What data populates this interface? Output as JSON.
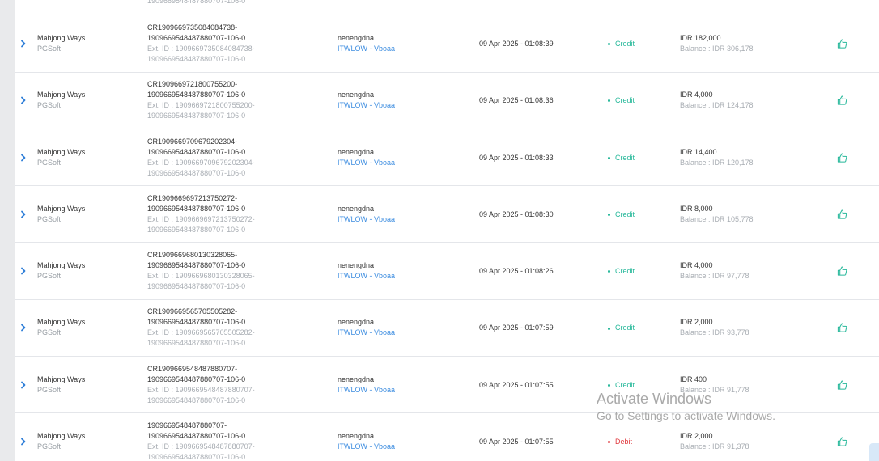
{
  "colors": {
    "credit": "#26b89a",
    "debit": "#e0393e",
    "link": "#3d8de0",
    "chevron": "#2f7fd8",
    "like_icon": "#26b89a"
  },
  "icons": {
    "expand": "chevron-right-icon",
    "like": "thumbs-up-icon"
  },
  "partial_top_row": {
    "ext_tail": "1909669548487880707-106-0"
  },
  "rows": [
    {
      "game": "Mahjong Ways",
      "provider": "PGSoft",
      "txn_line1": "CR1909669735084084738-",
      "txn_line2": "1909669548487880707-106-0",
      "ext_line1": "Ext. ID : 1909669735084084738-",
      "ext_line2": "1909669548487880707-106-0",
      "username": "nenengdna",
      "agent": "ITWLOW - Vboaa",
      "date": "09 Apr 2025 - 01:08:39",
      "type": "Credit",
      "type_kind": "credit",
      "amount": "IDR 182,000",
      "balance": "Balance : IDR 306,178"
    },
    {
      "game": "Mahjong Ways",
      "provider": "PGSoft",
      "txn_line1": "CR1909669721800755200-",
      "txn_line2": "1909669548487880707-106-0",
      "ext_line1": "Ext. ID : 1909669721800755200-",
      "ext_line2": "1909669548487880707-106-0",
      "username": "nenengdna",
      "agent": "ITWLOW - Vboaa",
      "date": "09 Apr 2025 - 01:08:36",
      "type": "Credit",
      "type_kind": "credit",
      "amount": "IDR 4,000",
      "balance": "Balance : IDR 124,178"
    },
    {
      "game": "Mahjong Ways",
      "provider": "PGSoft",
      "txn_line1": "CR1909669709679202304-",
      "txn_line2": "1909669548487880707-106-0",
      "ext_line1": "Ext. ID : 1909669709679202304-",
      "ext_line2": "1909669548487880707-106-0",
      "username": "nenengdna",
      "agent": "ITWLOW - Vboaa",
      "date": "09 Apr 2025 - 01:08:33",
      "type": "Credit",
      "type_kind": "credit",
      "amount": "IDR 14,400",
      "balance": "Balance : IDR 120,178"
    },
    {
      "game": "Mahjong Ways",
      "provider": "PGSoft",
      "txn_line1": "CR1909669697213750272-",
      "txn_line2": "1909669548487880707-106-0",
      "ext_line1": "Ext. ID : 1909669697213750272-",
      "ext_line2": "1909669548487880707-106-0",
      "username": "nenengdna",
      "agent": "ITWLOW - Vboaa",
      "date": "09 Apr 2025 - 01:08:30",
      "type": "Credit",
      "type_kind": "credit",
      "amount": "IDR 8,000",
      "balance": "Balance : IDR 105,778"
    },
    {
      "game": "Mahjong Ways",
      "provider": "PGSoft",
      "txn_line1": "CR1909669680130328065-",
      "txn_line2": "1909669548487880707-106-0",
      "ext_line1": "Ext. ID : 1909669680130328065-",
      "ext_line2": "1909669548487880707-106-0",
      "username": "nenengdna",
      "agent": "ITWLOW - Vboaa",
      "date": "09 Apr 2025 - 01:08:26",
      "type": "Credit",
      "type_kind": "credit",
      "amount": "IDR 4,000",
      "balance": "Balance : IDR 97,778"
    },
    {
      "game": "Mahjong Ways",
      "provider": "PGSoft",
      "txn_line1": "CR1909669565705505282-",
      "txn_line2": "1909669548487880707-106-0",
      "ext_line1": "Ext. ID : 1909669565705505282-",
      "ext_line2": "1909669548487880707-106-0",
      "username": "nenengdna",
      "agent": "ITWLOW - Vboaa",
      "date": "09 Apr 2025 - 01:07:59",
      "type": "Credit",
      "type_kind": "credit",
      "amount": "IDR 2,000",
      "balance": "Balance : IDR 93,778"
    },
    {
      "game": "Mahjong Ways",
      "provider": "PGSoft",
      "txn_line1": "CR1909669548487880707-",
      "txn_line2": "1909669548487880707-106-0",
      "ext_line1": "Ext. ID : 1909669548487880707-",
      "ext_line2": "1909669548487880707-106-0",
      "username": "nenengdna",
      "agent": "ITWLOW - Vboaa",
      "date": "09 Apr 2025 - 01:07:55",
      "type": "Credit",
      "type_kind": "credit",
      "amount": "IDR 400",
      "balance": "Balance : IDR 91,778"
    },
    {
      "game": "Mahjong Ways",
      "provider": "PGSoft",
      "txn_line1": "1909669548487880707-",
      "txn_line2": "1909669548487880707-106-0",
      "ext_line1": "Ext. ID : 1909669548487880707-",
      "ext_line2": "1909669548487880707-106-0",
      "username": "nenengdna",
      "agent": "ITWLOW - Vboaa",
      "date": "09 Apr 2025 - 01:07:55",
      "type": "Debit",
      "type_kind": "debit",
      "amount": "IDR 2,000",
      "balance": "Balance : IDR 91,378"
    }
  ],
  "watermark": {
    "title": "Activate Windows",
    "subtitle": "Go to Settings to activate Windows."
  }
}
